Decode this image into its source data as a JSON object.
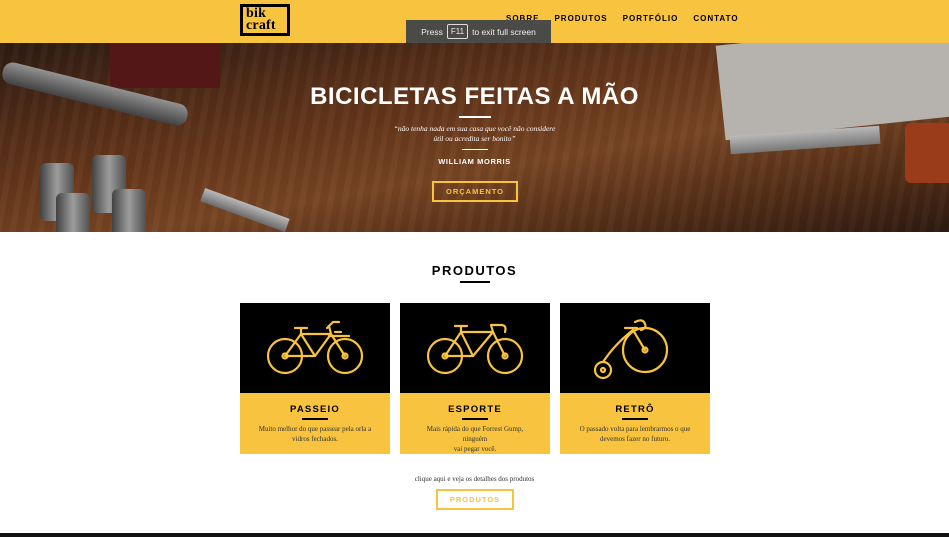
{
  "header": {
    "logo_line1": "bik",
    "logo_line2": "craft",
    "nav": [
      "SOBRE",
      "PRODUTOS",
      "PORTFÓLIO",
      "CONTATO"
    ]
  },
  "fullscreen_notice": {
    "press": "Press",
    "key": "F11",
    "message": "to exit full screen"
  },
  "hero": {
    "title": "BICICLETAS FEITAS A MÃO",
    "quote_line1": "“não tenha nada em sua casa que você não considere",
    "quote_line2": "útil ou acredita ser bonito”",
    "author": "WILLIAM MORRIS",
    "button": "ORÇAMENTO"
  },
  "products": {
    "title": "PRODUTOS",
    "items": [
      {
        "name": "PASSEIO",
        "desc_line1": "Muito melhor do que passear pela orla a",
        "desc_line2": "vidros fechados.",
        "icon": "city-bike-icon"
      },
      {
        "name": "ESPORTE",
        "desc_line1": "Mais rápida do que Forrest Gump, ninguém",
        "desc_line2": "vai pegar você.",
        "icon": "road-bike-icon"
      },
      {
        "name": "RETRÔ",
        "desc_line1": "O passado volta para lembrarmos o que",
        "desc_line2": "devemos fazer no futuro.",
        "icon": "penny-farthing-icon"
      }
    ],
    "hint": "clique aqui e veja os detalhes dos produtos",
    "button": "PRODUTOS"
  },
  "colors": {
    "accent": "#F8C33E",
    "dark": "#000000"
  }
}
